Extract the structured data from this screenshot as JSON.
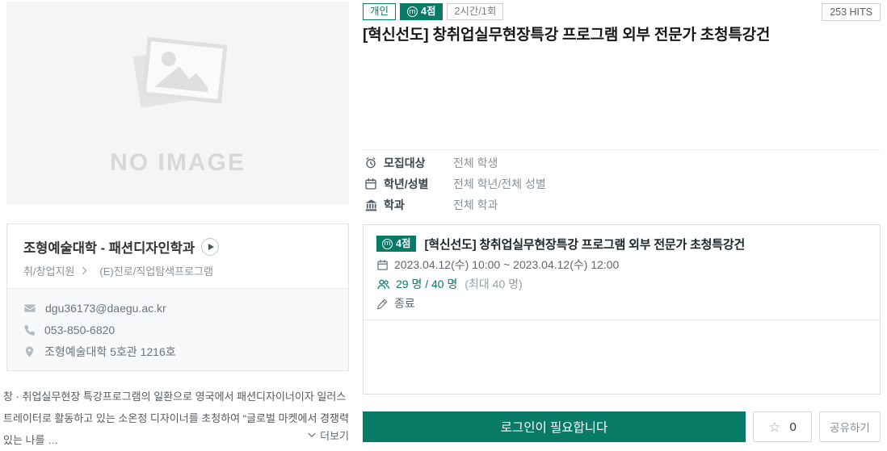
{
  "colors": {
    "teal": "#087b67",
    "card_border": "#dcdfe2",
    "placeholder_bg": "#f5f5f6"
  },
  "left": {
    "no_image_label": "NO IMAGE",
    "dept_card": {
      "title": "조형예술대학 - 패션디자인학과",
      "category": "취/창업지원",
      "program_type": "(E)진로/직업탐색프로그램",
      "contacts": [
        {
          "icon": "email-icon",
          "value": "dgu36173@daegu.ac.kr"
        },
        {
          "icon": "phone-icon",
          "value": "053-850-6820"
        },
        {
          "icon": "location-icon",
          "value": "조형예술대학 5호관 1216호"
        }
      ]
    },
    "description": "창 · 취업실무현장 특강프로그램의 일환으로 영국에서 패션디자이너이자 일러스트레이터로 활동하고 있는 소온정 디자이너를 초청하여 “글로벌 마켓에서 경쟁력있는 나를 …",
    "more_label": "더보기"
  },
  "main": {
    "badges": [
      {
        "label": "개인",
        "style": "outline-teal"
      },
      {
        "label": "4점",
        "icon": "m-circle-icon",
        "icon_glyph": "m",
        "style": "filled-teal"
      },
      {
        "label": "2시간/1회",
        "style": "outline-gray"
      }
    ],
    "hits": "253 HITS",
    "title": "[혁신선도] 창취업실무현장특강 프로그램 외부 전문가 초청특강건",
    "info_rows": [
      {
        "icon": "alarm-clock-icon",
        "label": "모집대상",
        "value": "전체 학생"
      },
      {
        "icon": "calendar-icon",
        "label": "학년/성별",
        "value": "전체 학년/전체 성별"
      },
      {
        "icon": "bank-icon",
        "label": "학과",
        "value": "전체 학과"
      }
    ],
    "session_card": {
      "badge_label": "4점",
      "badge_icon_glyph": "m",
      "title": "[혁신선도] 창취업실무현장특강 프로그램 외부 전문가 초청특강건",
      "schedule": "2023.04.12(수) 10:00 ~ 2023.04.12(수) 12:00",
      "capacity_current": "29 명 / 40 명",
      "capacity_max": "(최대 40 명)",
      "status": "종료"
    },
    "footer": {
      "login_button": "로그인이 필요합니다",
      "star_glyph": "☆",
      "favorite_count": "0",
      "share_button": "공유하기"
    }
  }
}
